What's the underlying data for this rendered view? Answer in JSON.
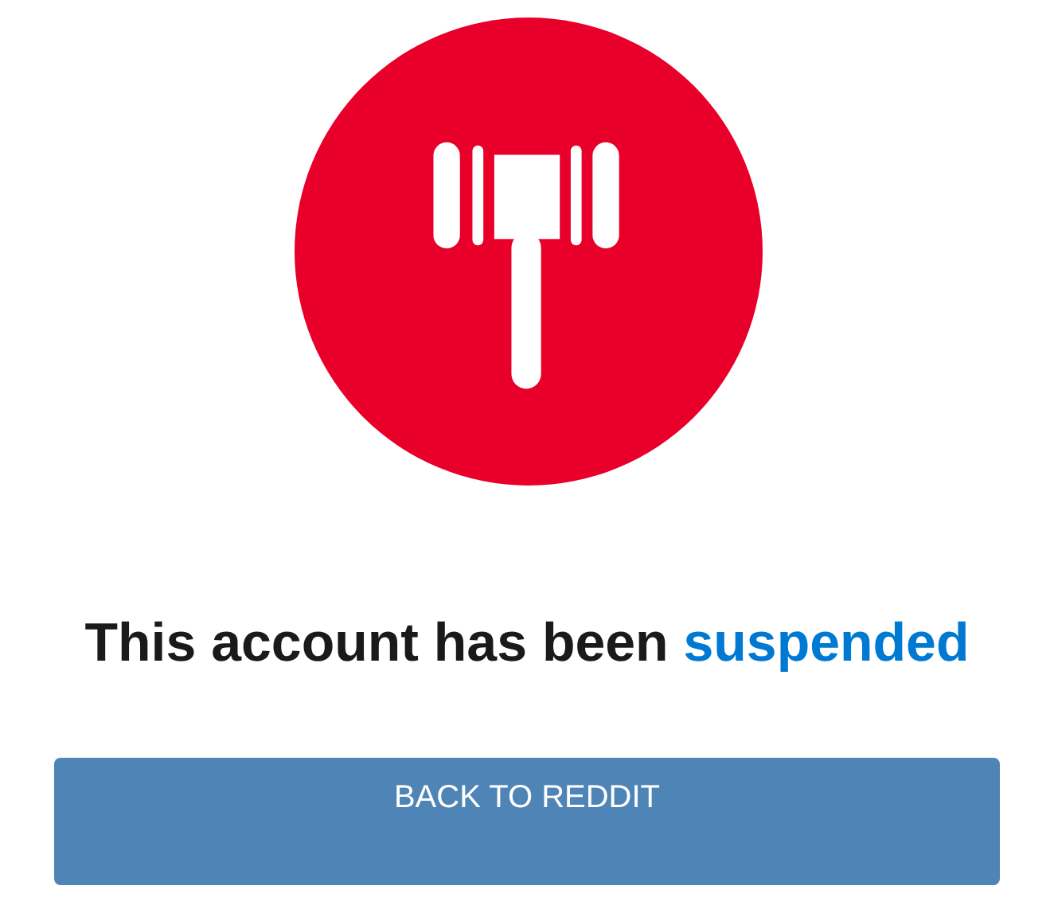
{
  "heading": {
    "text": "This account has been",
    "highlight": "suspended"
  },
  "button": {
    "label": "BACK TO REDDIT"
  }
}
